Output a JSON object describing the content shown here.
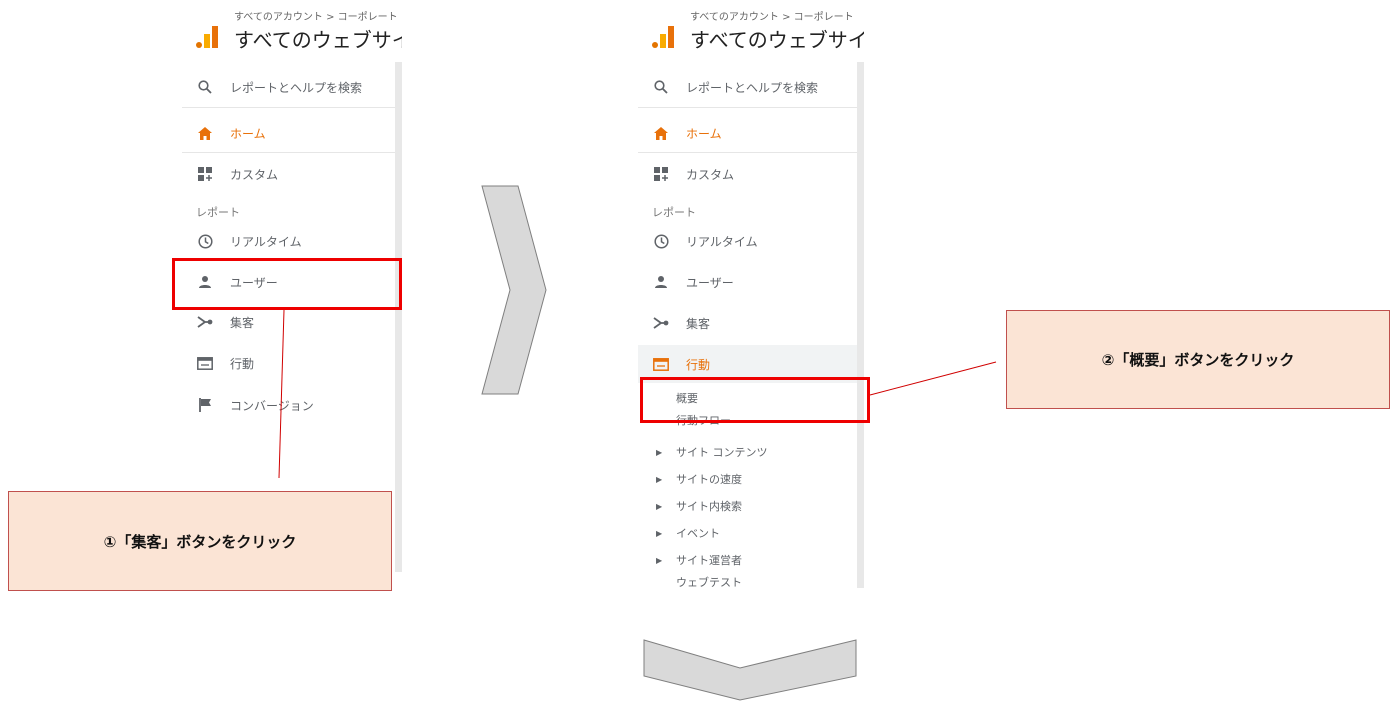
{
  "panel_left": {
    "breadcrumb": "すべてのアカウント > コーポレート",
    "site_name": "すべてのウェブサイト",
    "search_label": "レポートとヘルプを検索",
    "home_label": "ホーム",
    "custom_label": "カスタム",
    "reports_heading": "レポート",
    "realtime_label": "リアルタイム",
    "user_label": "ユーザー",
    "acquisition_label": "集客",
    "behavior_label": "行動",
    "conversion_label": "コンバージョン"
  },
  "panel_right": {
    "breadcrumb": "すべてのアカウント > コーポレート",
    "site_name": "すべてのウェブサイト",
    "search_label": "レポートとヘルプを検索",
    "home_label": "ホーム",
    "custom_label": "カスタム",
    "reports_heading": "レポート",
    "realtime_label": "リアルタイム",
    "user_label": "ユーザー",
    "acquisition_label": "集客",
    "behavior_label": "行動",
    "submenu": [
      {
        "label": "概要"
      },
      {
        "label": "行動フロー"
      },
      {
        "label": "サイト コンテンツ"
      },
      {
        "label": "サイトの速度"
      },
      {
        "label": "サイト内検索"
      },
      {
        "label": "イベント"
      },
      {
        "label": "サイト運営者"
      },
      {
        "label": "ウェブテスト"
      }
    ]
  },
  "callouts": {
    "step1": "①「集客」ボタンをクリック",
    "step2": "②「概要」ボタンをクリック"
  },
  "colors": {
    "highlight_border": "#ee0000",
    "callout_fill": "#fbe4d5",
    "accent_orange": "#e8710a",
    "arrow_fill": "#d9d9d9"
  }
}
